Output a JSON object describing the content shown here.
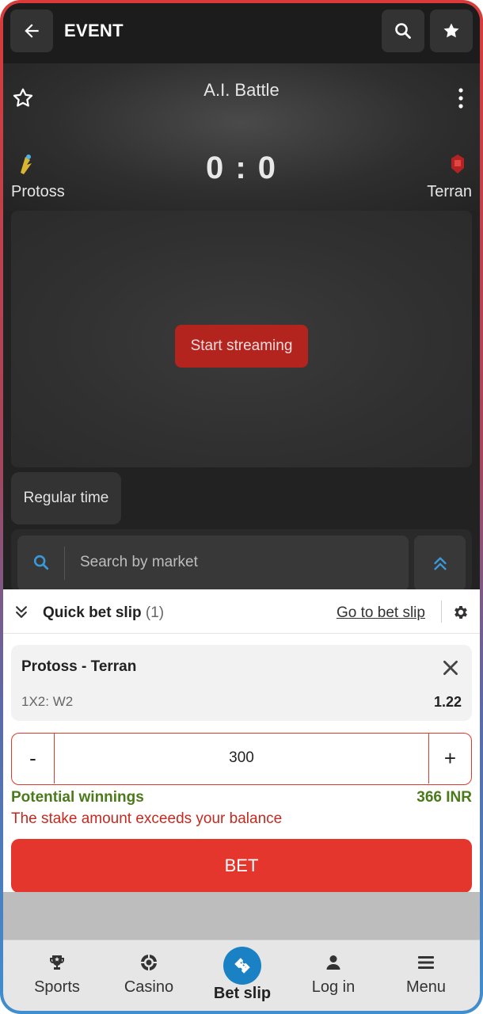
{
  "header": {
    "title": "EVENT",
    "back_icon": "arrow-left-icon",
    "search_icon": "search-icon",
    "favorites_icon": "star-icon"
  },
  "event": {
    "title": "A.I. Battle",
    "score": "0 : 0",
    "team1": "Protoss",
    "team2": "Terran"
  },
  "stream": {
    "button_label": "Start streaming"
  },
  "period": {
    "label": "Regular time"
  },
  "market_search": {
    "placeholder": "Search by market"
  },
  "bet_slip": {
    "title": "Quick bet slip",
    "count": "(1)",
    "go_to_label": "Go to bet slip",
    "selection": {
      "match": "Protoss - Terran",
      "market": "1X2: W2",
      "odds": "1.22"
    },
    "stake": {
      "minus": "-",
      "value": "300",
      "plus": "+"
    },
    "potential_label": "Potential winnings",
    "potential_value": "366 INR",
    "error": "The stake amount exceeds your balance",
    "bet_label": "BET"
  },
  "nav": [
    {
      "label": "Sports",
      "icon": "trophy-icon"
    },
    {
      "label": "Casino",
      "icon": "casino-chip-icon"
    },
    {
      "label": "Bet slip",
      "icon": "ticket-icon",
      "active": true
    },
    {
      "label": "Log in",
      "icon": "user-icon"
    },
    {
      "label": "Menu",
      "icon": "menu-icon"
    }
  ],
  "colors": {
    "accent_red": "#e5362d",
    "error_red": "#c62a1f",
    "winnings_green": "#4b7a1a",
    "active_blue": "#1a82c4",
    "link_blue": "#3a9ad9"
  }
}
